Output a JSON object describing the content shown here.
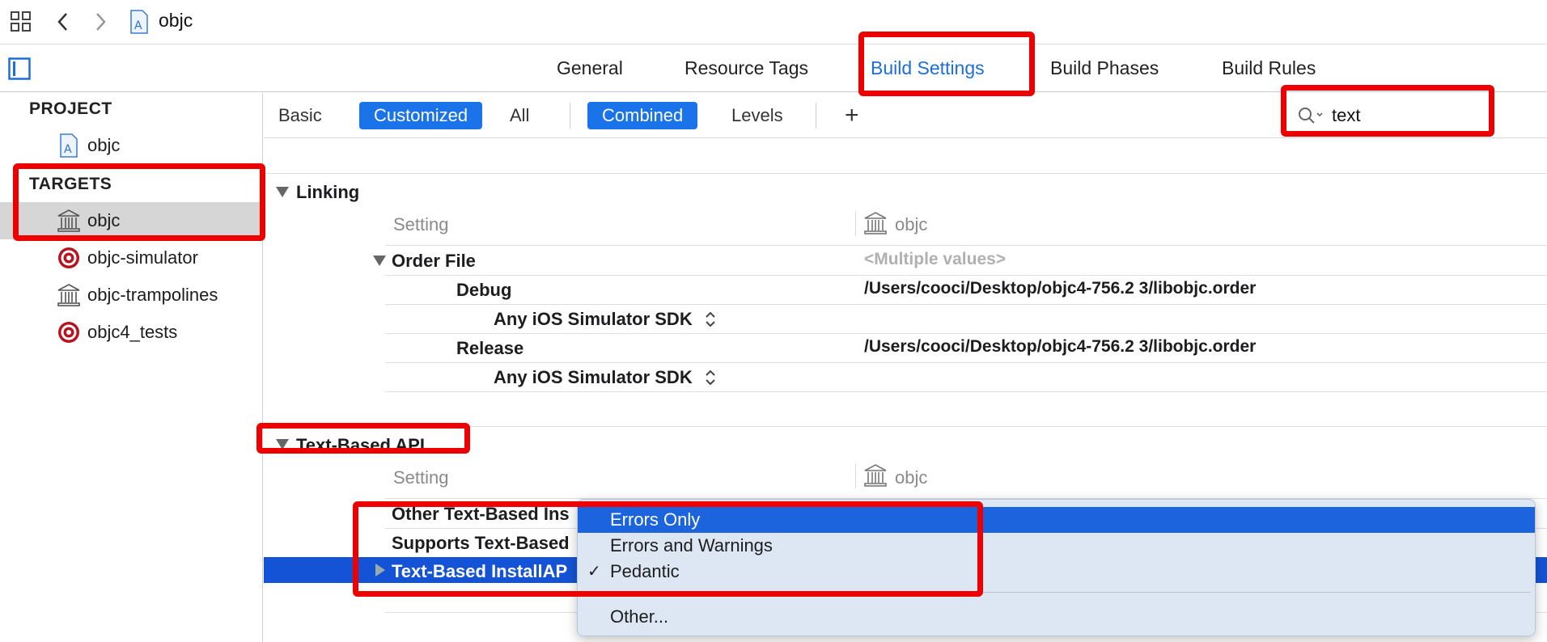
{
  "toolbar": {
    "file_title": "objc"
  },
  "tabs": [
    {
      "label": "General"
    },
    {
      "label": "Resource Tags"
    },
    {
      "label": "Build Settings",
      "active": true
    },
    {
      "label": "Build Phases"
    },
    {
      "label": "Build Rules"
    }
  ],
  "sidebar": {
    "project_header": "PROJECT",
    "project_item": "objc",
    "targets_header": "TARGETS",
    "targets": [
      {
        "label": "objc",
        "icon": "library-icon",
        "selected": true
      },
      {
        "label": "objc-simulator",
        "icon": "target-icon"
      },
      {
        "label": "objc-trampolines",
        "icon": "library-icon"
      },
      {
        "label": "objc4_tests",
        "icon": "target-icon"
      }
    ]
  },
  "filters": {
    "basic": "Basic",
    "customized": "Customized",
    "all": "All",
    "combined": "Combined",
    "levels": "Levels",
    "add": "+",
    "search_value": "text"
  },
  "linking": {
    "title": "Linking",
    "col_setting": "Setting",
    "col_target": "objc",
    "order_file": "Order File",
    "order_file_value": "<Multiple values>",
    "debug": "Debug",
    "debug_value": "/Users/cooci/Desktop/objc4-756.2 3/libobjc.order",
    "sdk_1": "Any iOS Simulator SDK",
    "release": "Release",
    "release_value": "/Users/cooci/Desktop/objc4-756.2 3/libobjc.order",
    "sdk_2": "Any iOS Simulator SDK"
  },
  "text_based_api": {
    "title": "Text-Based API",
    "col_setting": "Setting",
    "col_target": "objc",
    "row_1": "Other Text-Based Ins",
    "row_2": "Supports Text-Based",
    "row_3": "Text-Based InstallAP"
  },
  "dropdown": {
    "items": [
      "Errors Only",
      "Errors and Warnings",
      "Pedantic"
    ],
    "checked": "Pedantic",
    "other": "Other..."
  },
  "colors": {
    "accent": "#1a73e8",
    "selection": "#1553d6",
    "annotation": "#ee0000"
  }
}
